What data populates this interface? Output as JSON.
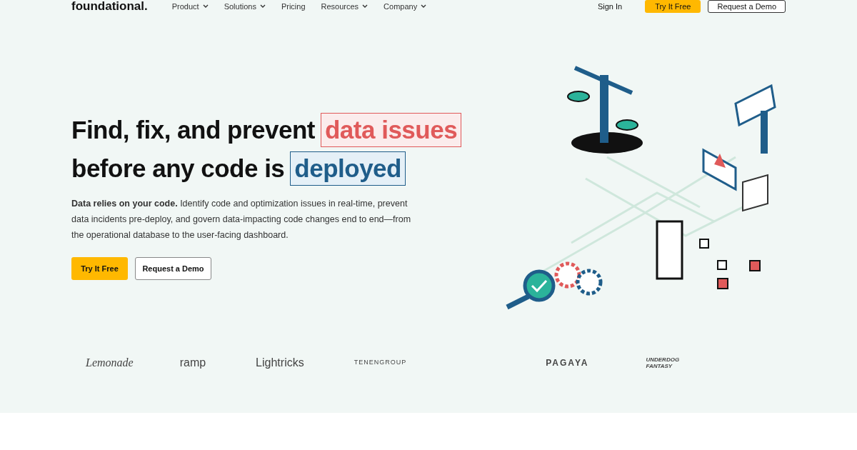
{
  "nav": {
    "logo": "foundational.",
    "items": [
      {
        "label": "Product",
        "dropdown": true
      },
      {
        "label": "Solutions",
        "dropdown": true
      },
      {
        "label": "Pricing",
        "dropdown": false
      },
      {
        "label": "Resources",
        "dropdown": true
      },
      {
        "label": "Company",
        "dropdown": true
      }
    ],
    "sign_in": "Sign In",
    "try_button": "Try It Free",
    "demo_button": "Request a Demo"
  },
  "hero": {
    "headline_1": "Find, fix, and prevent",
    "highlight_1": "data issues",
    "headline_2": "before any code is",
    "highlight_2": "deployed",
    "body": "**Data relies on your code.** Identify code and optimization issues in real-time, prevent data incidents pre-deploy,  and govern data-impacting code changes end to end—from the operational database to the user-facing dashboard.",
    "try_button": "Try It Free",
    "demo_button": "Request a Demo"
  },
  "logos": [
    "Lemonade",
    "ramp",
    "Lightricks",
    "TENENGROUP",
    "PAGAYA",
    "UNDERDOG FANTASY"
  ]
}
